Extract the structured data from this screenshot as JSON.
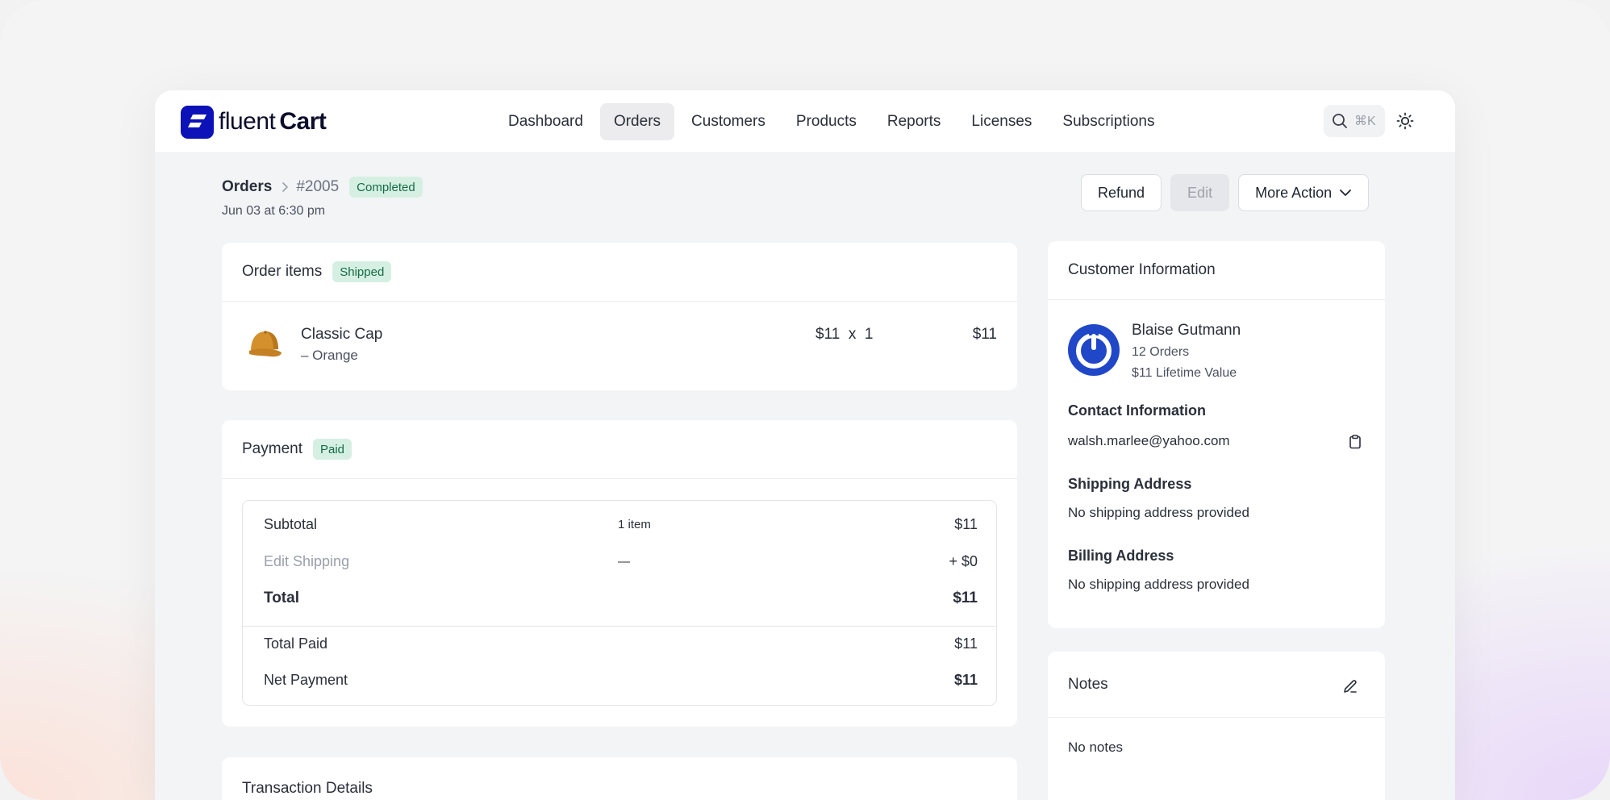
{
  "app": {
    "logo_word1": "fluent",
    "logo_word2": "Cart",
    "brand_color": "#0c12b8"
  },
  "nav": {
    "items": [
      {
        "label": "Dashboard",
        "active": false
      },
      {
        "label": "Orders",
        "active": true
      },
      {
        "label": "Customers",
        "active": false
      },
      {
        "label": "Products",
        "active": false
      },
      {
        "label": "Reports",
        "active": false
      },
      {
        "label": "Licenses",
        "active": false
      },
      {
        "label": "Subscriptions",
        "active": false
      }
    ],
    "search_icon": "search-icon",
    "search_shortcut": "⌘K",
    "theme_icon": "sun-icon"
  },
  "order": {
    "breadcrumb_root": "Orders",
    "order_id": "#2005",
    "status": "Completed",
    "date": "Jun 03 at 6:30 pm",
    "actions": {
      "refund": "Refund",
      "edit": "Edit",
      "more": "More Action"
    }
  },
  "items_card": {
    "title": "Order items",
    "status": "Shipped",
    "items": [
      {
        "name": "Classic Cap",
        "variant": "– Orange",
        "price_qty": "$11  x  1",
        "total": "$11",
        "icon": "cap-icon"
      }
    ]
  },
  "payment_card": {
    "title": "Payment",
    "status": "Paid",
    "subtotal_label": "Subtotal",
    "subtotal_count": "1 item",
    "subtotal_value": "$11",
    "shipping_label": "Edit Shipping",
    "shipping_mid": "—",
    "shipping_value": "+ $0",
    "total_label": "Total",
    "total_value": "$11",
    "total_paid_label": "Total Paid",
    "total_paid_value": "$11",
    "net_label": "Net Payment",
    "net_value": "$11"
  },
  "transaction_card": {
    "title": "Transaction Details"
  },
  "customer_card": {
    "title": "Customer Information",
    "name": "Blaise Gutmann",
    "orders": "12 Orders",
    "ltv": "$11 Lifetime Value",
    "contact_title": "Contact Information",
    "email": "walsh.marlee@yahoo.com",
    "shipping_title": "Shipping Address",
    "shipping_text": "No shipping address provided",
    "billing_title": "Billing Address",
    "billing_text": "No shipping address provided",
    "avatar_color": "#1f47c8"
  },
  "notes_card": {
    "title": "Notes",
    "text": "No notes"
  }
}
